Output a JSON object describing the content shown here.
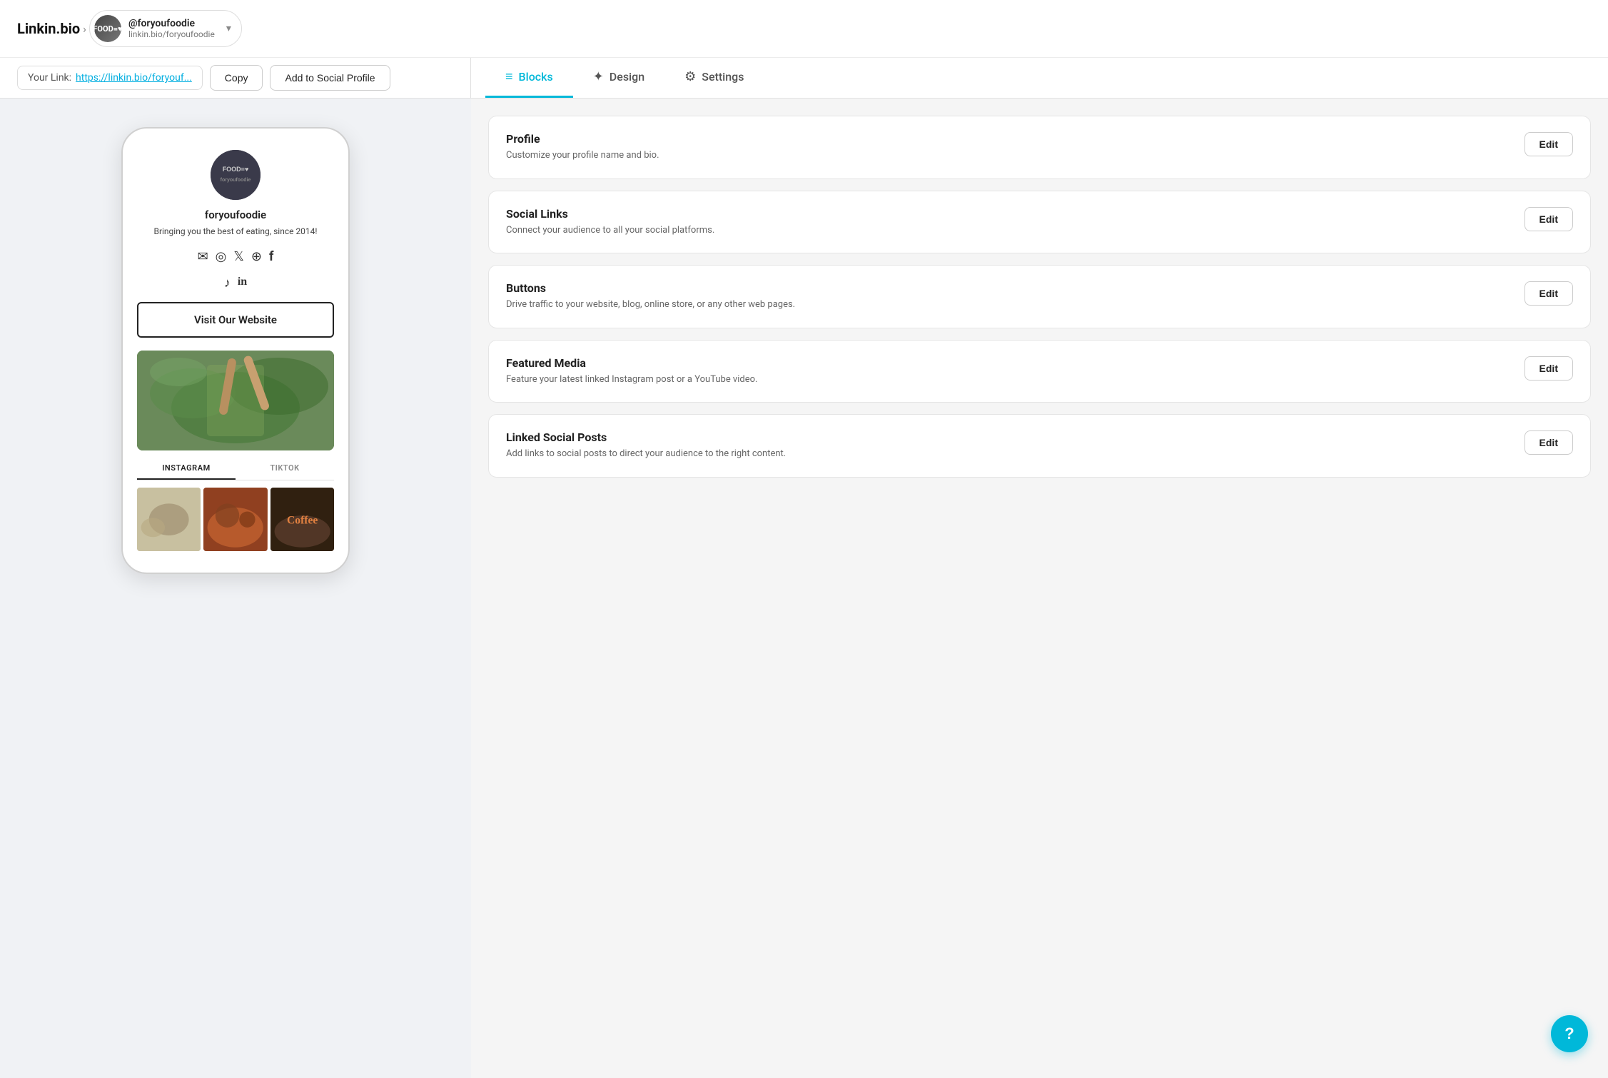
{
  "nav": {
    "brand": "Linkin.bio",
    "chevron": "›",
    "account": {
      "handle": "@foryoufoodie",
      "url": "linkin.bio/foryoufoodie",
      "avatar_label": "FOOD=♥"
    },
    "dropdown_icon": "▾"
  },
  "link_bar": {
    "label": "Your Link:",
    "url_display": "https://linkin.bio/foryouf...",
    "copy_btn": "Copy",
    "social_btn": "Add to Social Profile"
  },
  "tabs": [
    {
      "id": "blocks",
      "label": "Blocks",
      "icon": "≡",
      "active": true
    },
    {
      "id": "design",
      "label": "Design",
      "icon": "✦",
      "active": false
    },
    {
      "id": "settings",
      "label": "Settings",
      "icon": "⚙",
      "active": false
    }
  ],
  "phone_preview": {
    "avatar_label": "FOOD=♥",
    "username": "foryoufoodie",
    "bio": "Bringing you the best of eating, since 2014!",
    "social_icons": [
      "✉",
      "◎",
      "✖",
      "⊕",
      "f",
      "♪",
      "in"
    ],
    "cta_button": "Visit Our Website",
    "tabs": [
      {
        "label": "INSTAGRAM",
        "active": true
      },
      {
        "label": "TIKTOK",
        "active": false
      }
    ]
  },
  "blocks": [
    {
      "id": "profile",
      "title": "Profile",
      "desc": "Customize your profile name and bio.",
      "edit_label": "Edit"
    },
    {
      "id": "social-links",
      "title": "Social Links",
      "desc": "Connect your audience to all your social platforms.",
      "edit_label": "Edit"
    },
    {
      "id": "buttons",
      "title": "Buttons",
      "desc": "Drive traffic to your website, blog, online store, or any other web pages.",
      "edit_label": "Edit"
    },
    {
      "id": "featured-media",
      "title": "Featured Media",
      "desc": "Feature your latest linked Instagram post or a YouTube video.",
      "edit_label": "Edit"
    },
    {
      "id": "linked-social-posts",
      "title": "Linked Social Posts",
      "desc": "Add links to social posts to direct your audience to the right content.",
      "edit_label": "Edit"
    }
  ],
  "help_btn": "?"
}
